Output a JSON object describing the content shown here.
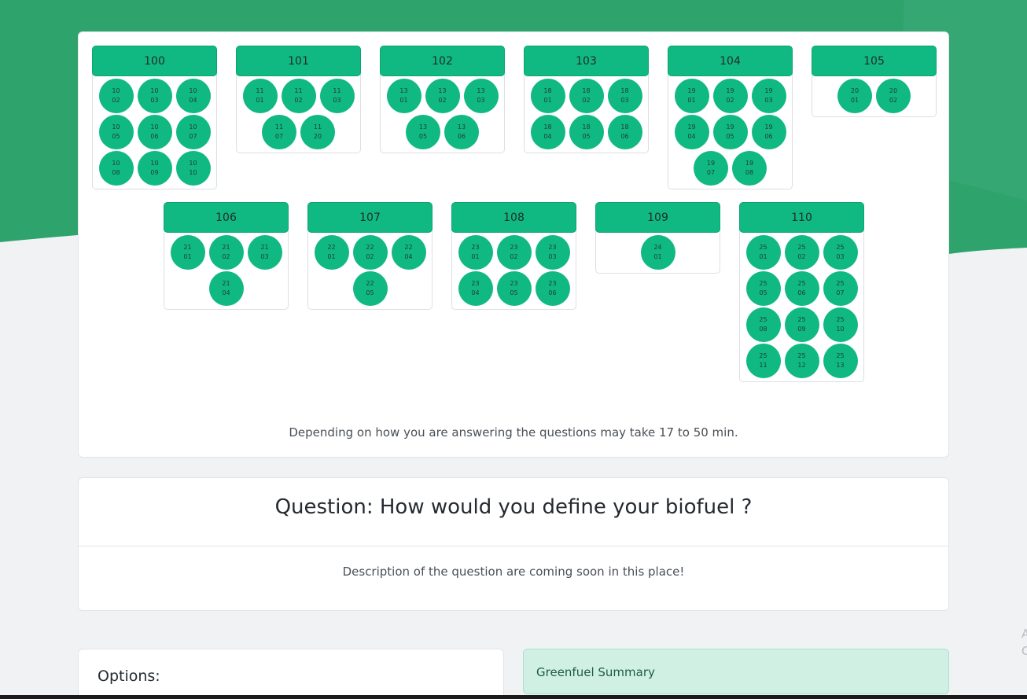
{
  "colors": {
    "accent": "#10b981",
    "hero_green": "#2ea36c",
    "summary_bg": "#d1f0e4"
  },
  "groups": [
    {
      "label": "100",
      "items": [
        [
          "10",
          "02"
        ],
        [
          "10",
          "03"
        ],
        [
          "10",
          "04"
        ],
        [
          "10",
          "05"
        ],
        [
          "10",
          "06"
        ],
        [
          "10",
          "07"
        ],
        [
          "10",
          "08"
        ],
        [
          "10",
          "09"
        ],
        [
          "10",
          "10"
        ]
      ]
    },
    {
      "label": "101",
      "items": [
        [
          "11",
          "01"
        ],
        [
          "11",
          "02"
        ],
        [
          "11",
          "03"
        ],
        [
          "11",
          "07"
        ],
        [
          "11",
          "20"
        ]
      ]
    },
    {
      "label": "102",
      "items": [
        [
          "13",
          "01"
        ],
        [
          "13",
          "02"
        ],
        [
          "13",
          "03"
        ],
        [
          "13",
          "05"
        ],
        [
          "13",
          "06"
        ]
      ]
    },
    {
      "label": "103",
      "items": [
        [
          "18",
          "01"
        ],
        [
          "18",
          "02"
        ],
        [
          "18",
          "03"
        ],
        [
          "18",
          "04"
        ],
        [
          "18",
          "05"
        ],
        [
          "18",
          "06"
        ]
      ]
    },
    {
      "label": "104",
      "items": [
        [
          "19",
          "01"
        ],
        [
          "19",
          "02"
        ],
        [
          "19",
          "03"
        ],
        [
          "19",
          "04"
        ],
        [
          "19",
          "05"
        ],
        [
          "19",
          "06"
        ],
        [
          "19",
          "07"
        ],
        [
          "19",
          "08"
        ]
      ]
    },
    {
      "label": "105",
      "items": [
        [
          "20",
          "01"
        ],
        [
          "20",
          "02"
        ]
      ]
    },
    {
      "label": "106",
      "items": [
        [
          "21",
          "01"
        ],
        [
          "21",
          "02"
        ],
        [
          "21",
          "03"
        ],
        [
          "21",
          "04"
        ]
      ]
    },
    {
      "label": "107",
      "items": [
        [
          "22",
          "01"
        ],
        [
          "22",
          "02"
        ],
        [
          "22",
          "04"
        ],
        [
          "22",
          "05"
        ]
      ]
    },
    {
      "label": "108",
      "items": [
        [
          "23",
          "01"
        ],
        [
          "23",
          "02"
        ],
        [
          "23",
          "03"
        ],
        [
          "23",
          "04"
        ],
        [
          "23",
          "05"
        ],
        [
          "23",
          "06"
        ]
      ]
    },
    {
      "label": "109",
      "items": [
        [
          "24",
          "01"
        ]
      ]
    },
    {
      "label": "110",
      "items": [
        [
          "25",
          "01"
        ],
        [
          "25",
          "02"
        ],
        [
          "25",
          "03"
        ],
        [
          "25",
          "05"
        ],
        [
          "25",
          "06"
        ],
        [
          "25",
          "07"
        ],
        [
          "25",
          "08"
        ],
        [
          "25",
          "09"
        ],
        [
          "25",
          "10"
        ],
        [
          "25",
          "11"
        ],
        [
          "25",
          "12"
        ],
        [
          "25",
          "13"
        ]
      ]
    }
  ],
  "duration_text": "Depending on how you are answering the questions may take 17 to 50 min.",
  "question": {
    "title": "Question: How would you define your biofuel ?",
    "description": "Description of the question are coming soon in this place!"
  },
  "options": {
    "title": "Options:"
  },
  "summary": {
    "title": "Greenfuel Summary"
  },
  "edge_text": [
    "A",
    "C"
  ]
}
